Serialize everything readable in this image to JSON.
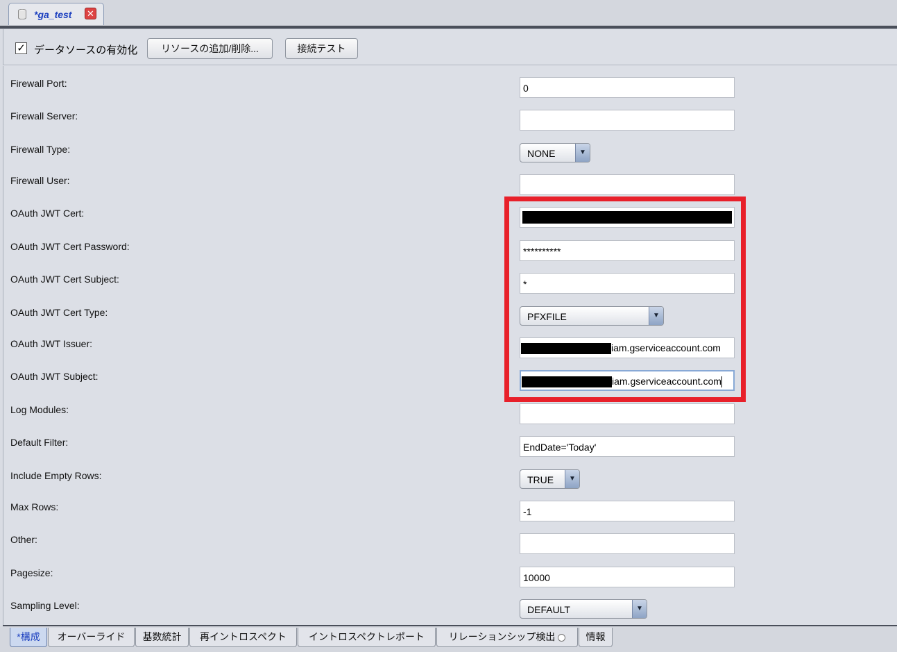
{
  "window": {
    "tab_title": "*ga_test"
  },
  "toolbar": {
    "enable_checkbox_label": "データソースの有効化",
    "add_remove_button": "リソースの追加/削除...",
    "test_button": "接続テスト"
  },
  "fields": {
    "firewall_port": {
      "label": "Firewall Port:",
      "value": "0"
    },
    "firewall_server": {
      "label": "Firewall Server:",
      "value": ""
    },
    "firewall_type": {
      "label": "Firewall Type:",
      "value": "NONE"
    },
    "firewall_user": {
      "label": "Firewall User:",
      "value": ""
    },
    "oauth_jwt_cert": {
      "label": "OAuth JWT Cert:",
      "value": ""
    },
    "oauth_jwt_cert_password": {
      "label": "OAuth JWT Cert Password:",
      "value": "**********"
    },
    "oauth_jwt_cert_subject": {
      "label": "OAuth JWT Cert Subject:",
      "value": "*"
    },
    "oauth_jwt_cert_type": {
      "label": "OAuth JWT Cert Type:",
      "value": "PFXFILE"
    },
    "oauth_jwt_issuer": {
      "label": "OAuth JWT Issuer:",
      "value": "iam.gserviceaccount.com"
    },
    "oauth_jwt_subject": {
      "label": "OAuth JWT Subject:",
      "value": "iam.gserviceaccount.com"
    },
    "log_modules": {
      "label": "Log Modules:",
      "value": ""
    },
    "default_filter": {
      "label": "Default Filter:",
      "value": "EndDate='Today'"
    },
    "include_empty_rows": {
      "label": "Include Empty Rows:",
      "value": "TRUE"
    },
    "max_rows": {
      "label": "Max Rows:",
      "value": "-1"
    },
    "other": {
      "label": "Other:",
      "value": ""
    },
    "pagesize": {
      "label": "Pagesize:",
      "value": "10000"
    },
    "sampling_level": {
      "label": "Sampling Level:",
      "value": "DEFAULT"
    }
  },
  "bottom_tabs": [
    "*構成",
    "オーバーライド",
    "基数統計",
    "再イントロスペクト",
    "イントロスペクトレポート",
    "リレーションシップ検出",
    "情報"
  ],
  "colors": {
    "highlight": "#e8202a",
    "active_tab_text": "#1b3fbf"
  }
}
